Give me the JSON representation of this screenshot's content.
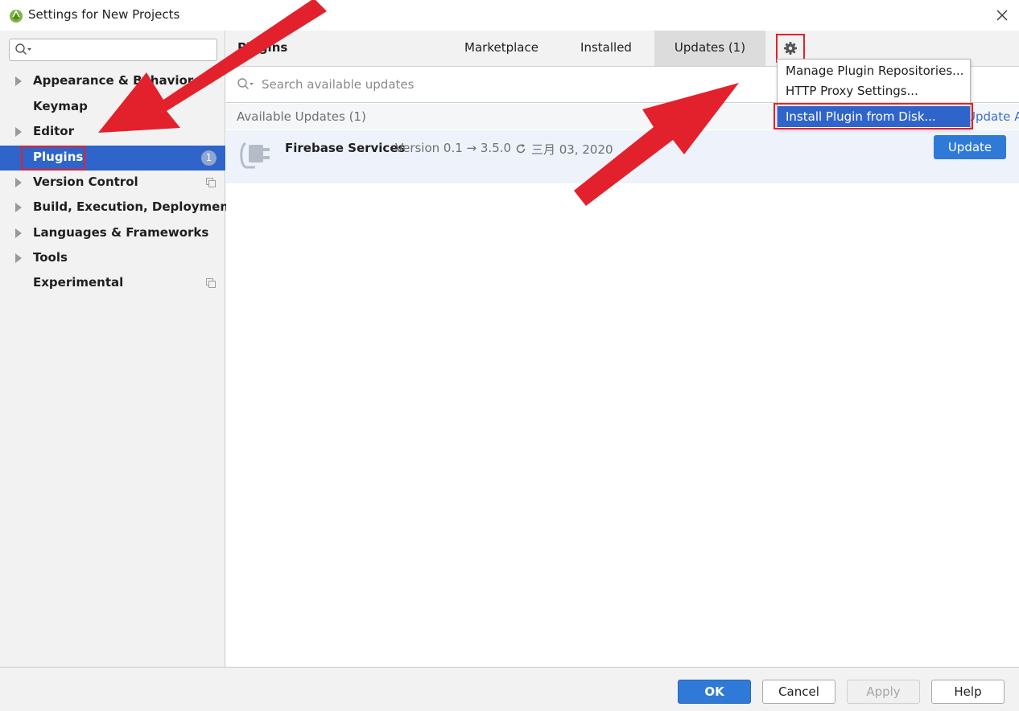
{
  "window": {
    "title": "Settings for New Projects",
    "close_glyph": "✕"
  },
  "sidebar": {
    "search_placeholder": "",
    "items": [
      {
        "label": "Appearance & Behavior",
        "expandable": true
      },
      {
        "label": "Keymap",
        "expandable": false
      },
      {
        "label": "Editor",
        "expandable": true
      },
      {
        "label": "Plugins",
        "expandable": false,
        "selected": true,
        "badge": "1"
      },
      {
        "label": "Version Control",
        "expandable": true,
        "project_icon": true
      },
      {
        "label": "Build, Execution, Deployment",
        "expandable": true
      },
      {
        "label": "Languages & Frameworks",
        "expandable": true
      },
      {
        "label": "Tools",
        "expandable": true
      },
      {
        "label": "Experimental",
        "expandable": false,
        "project_icon": true
      }
    ]
  },
  "plugins": {
    "section_title": "Plugins",
    "tabs": [
      {
        "label": "Marketplace"
      },
      {
        "label": "Installed"
      },
      {
        "label": "Updates (1)",
        "active": true
      }
    ],
    "search_placeholder": "Search available updates",
    "available_header": "Available Updates (1)",
    "update_all_label": "Update All",
    "update_row": {
      "name": "Firebase Services",
      "version": "Version 0.1 → 3.5.0",
      "date": "三月 03, 2020",
      "button_label": "Update"
    }
  },
  "gear_menu": {
    "items": [
      {
        "label": "Manage Plugin Repositories..."
      },
      {
        "label": "HTTP Proxy Settings..."
      },
      {
        "label": "Install Plugin from Disk...",
        "highlighted": true
      }
    ]
  },
  "footer": {
    "ok_label": "OK",
    "cancel_label": "Cancel",
    "apply_label": "Apply",
    "help_label": "Help"
  },
  "colors": {
    "selection_blue": "#2f65ca",
    "primary_button": "#2f7ad6",
    "annotation_red": "#e3212c",
    "sidebar_bg": "#f2f2f2"
  },
  "icons": {
    "app": "android-studio-icon",
    "search": "search-icon",
    "gear": "gear-icon",
    "plugin": "plug-icon",
    "refresh": "refresh-icon",
    "project_scope": "copy-icon"
  }
}
